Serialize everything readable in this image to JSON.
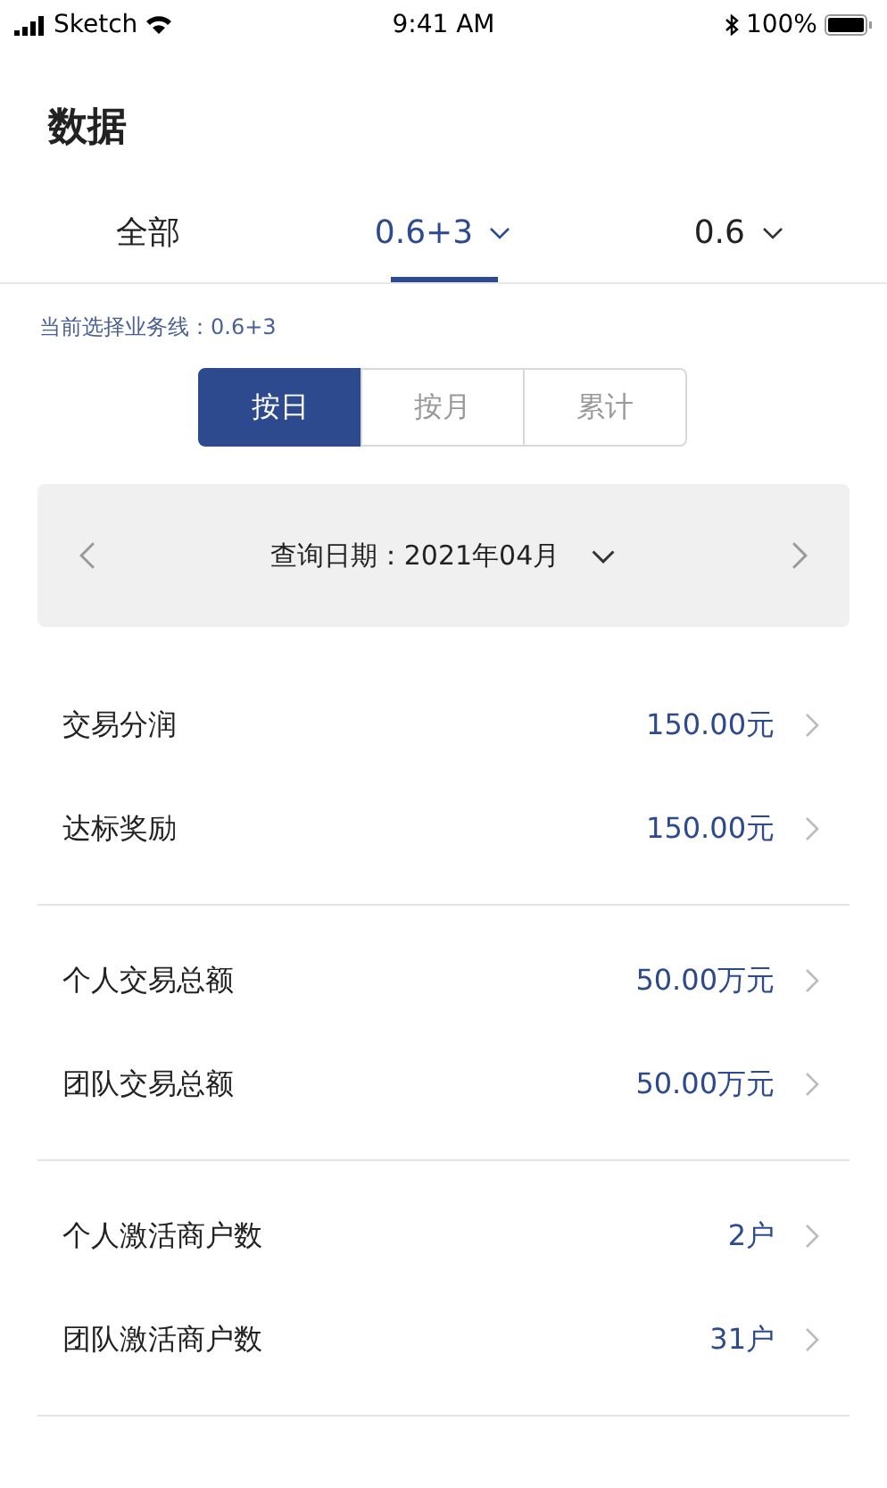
{
  "status_bar": {
    "carrier": "Sketch",
    "time": "9:41 AM",
    "battery": "100%"
  },
  "title": "数据",
  "tabs": [
    {
      "label": "全部",
      "selected": false,
      "dropdown": false
    },
    {
      "label": "0.6+3",
      "selected": true,
      "dropdown": true
    },
    {
      "label": "0.6",
      "selected": false,
      "dropdown": true
    }
  ],
  "current_line": "当前选择业务线：0.6+3",
  "periods": [
    {
      "label": "按日",
      "selected": true
    },
    {
      "label": "按月",
      "selected": false
    },
    {
      "label": "累计",
      "selected": false
    }
  ],
  "date_picker": {
    "label": "查询日期：2021年04月"
  },
  "groups": [
    [
      {
        "label": "交易分润",
        "value": "150.00元"
      },
      {
        "label": "达标奖励",
        "value": "150.00元"
      }
    ],
    [
      {
        "label": "个人交易总额",
        "value": "50.00万元"
      },
      {
        "label": "团队交易总额",
        "value": "50.00万元"
      }
    ],
    [
      {
        "label": "个人激活商户数",
        "value": "2户"
      },
      {
        "label": "团队激活商户数",
        "value": "31户"
      }
    ]
  ]
}
